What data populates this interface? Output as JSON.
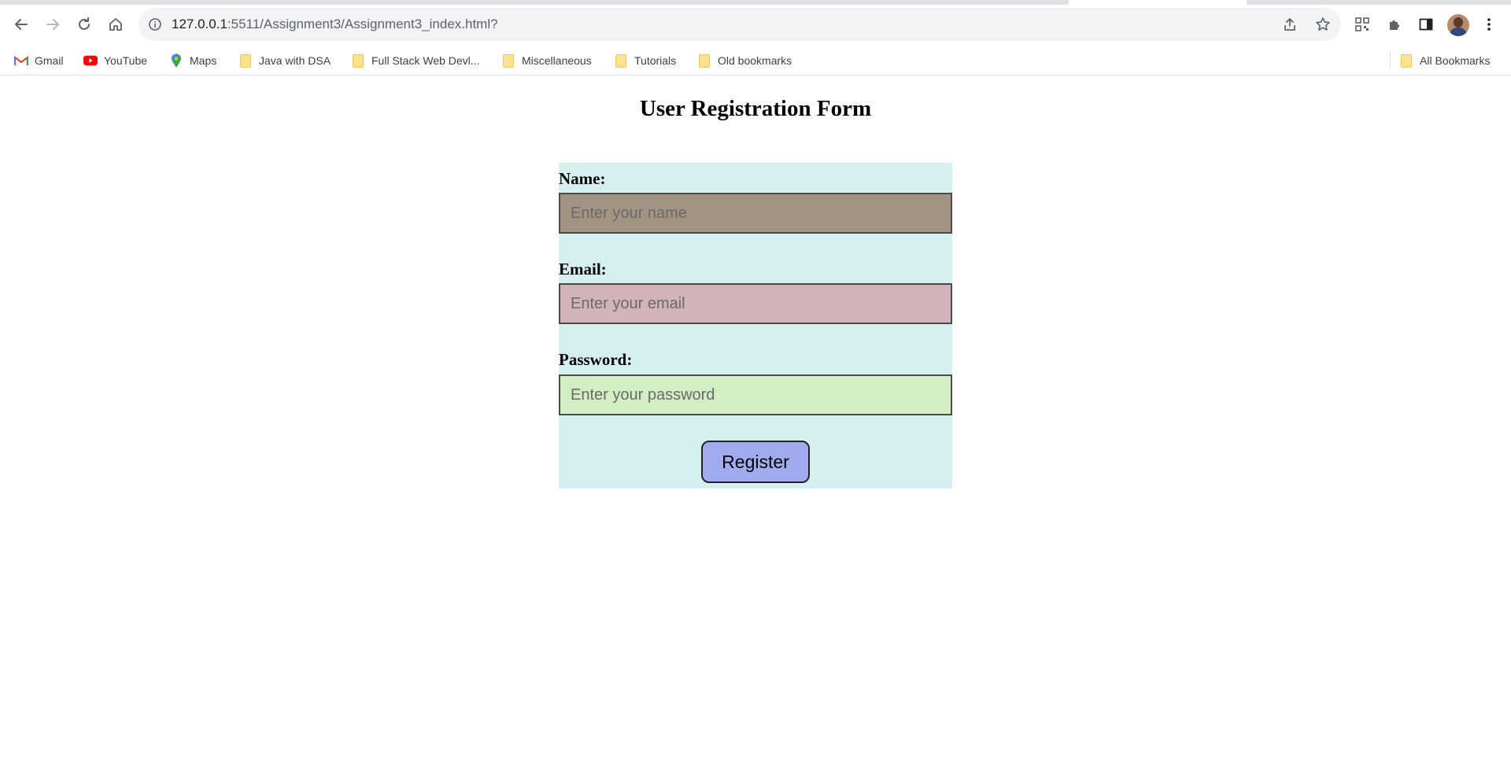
{
  "browser": {
    "url_host": "127.0.0.1",
    "url_rest": ":5511/Assignment3/Assignment3_index.html?",
    "bookmarks": [
      {
        "label": "Gmail",
        "icon": "gmail-icon"
      },
      {
        "label": "YouTube",
        "icon": "youtube-icon"
      },
      {
        "label": "Maps",
        "icon": "maps-icon"
      },
      {
        "label": "Java with DSA",
        "icon": "folder-icon"
      },
      {
        "label": "Full Stack Web Devl...",
        "icon": "folder-icon"
      },
      {
        "label": "Miscellaneous",
        "icon": "folder-icon"
      },
      {
        "label": "Tutorials",
        "icon": "folder-icon"
      },
      {
        "label": "Old bookmarks",
        "icon": "folder-icon"
      }
    ],
    "all_bookmarks": "All Bookmarks"
  },
  "page": {
    "title": "User Registration Form",
    "form": {
      "name_label": "Name:",
      "name_placeholder": "Enter your name",
      "name_color": "#a39382",
      "email_label": "Email:",
      "email_placeholder": "Enter your email",
      "email_color": "#d2b4b8",
      "password_label": "Password:",
      "password_placeholder": "Enter your password",
      "password_color": "#d3eec4",
      "submit_label": "Register",
      "submit_color": "#a2abf0",
      "background": "#d6f0f2"
    }
  }
}
